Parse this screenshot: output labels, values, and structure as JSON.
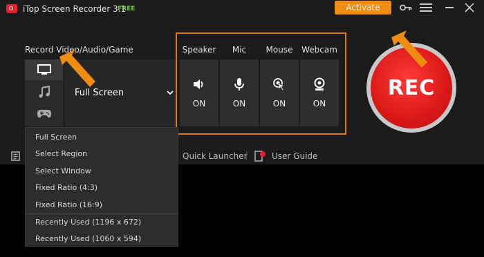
{
  "titlebar": {
    "title": "iTop Screen Recorder 3.1",
    "badge": "FREE",
    "activate_label": "Activate",
    "icons": [
      "key-icon",
      "menu-icon",
      "minimize-icon",
      "close-icon"
    ]
  },
  "record": {
    "label": "Record Video/Audio/Game",
    "sources": [
      {
        "name": "screen",
        "icon": "monitor-icon",
        "active": true
      },
      {
        "name": "audio",
        "icon": "music-icon",
        "active": false
      },
      {
        "name": "game",
        "icon": "gamepad-icon",
        "active": false
      }
    ],
    "mode_value": "Full Screen"
  },
  "devices": [
    {
      "label": "Speaker",
      "state": "ON",
      "icon": "speaker-icon"
    },
    {
      "label": "Mic",
      "state": "ON",
      "icon": "mic-icon"
    },
    {
      "label": "Mouse",
      "state": "ON",
      "icon": "mouse-click-icon"
    },
    {
      "label": "Webcam",
      "state": "ON",
      "icon": "webcam-icon"
    }
  ],
  "rec_label": "REC",
  "bottom_links": {
    "quick_launcher": "Quick Launcher",
    "user_guide": "User Guide"
  },
  "dropdown": {
    "items": [
      "Full Screen",
      "Select Region",
      "Select Window",
      "Fixed Ratio (4:3)",
      "Fixed Ratio (16:9)",
      "Recently Used (1196 x 672)",
      "Recently Used (1060 x 594)"
    ]
  },
  "colors": {
    "accent": "#f08c10",
    "frame": "#e07a18",
    "rec": "#d91818",
    "free": "#7ac943"
  }
}
